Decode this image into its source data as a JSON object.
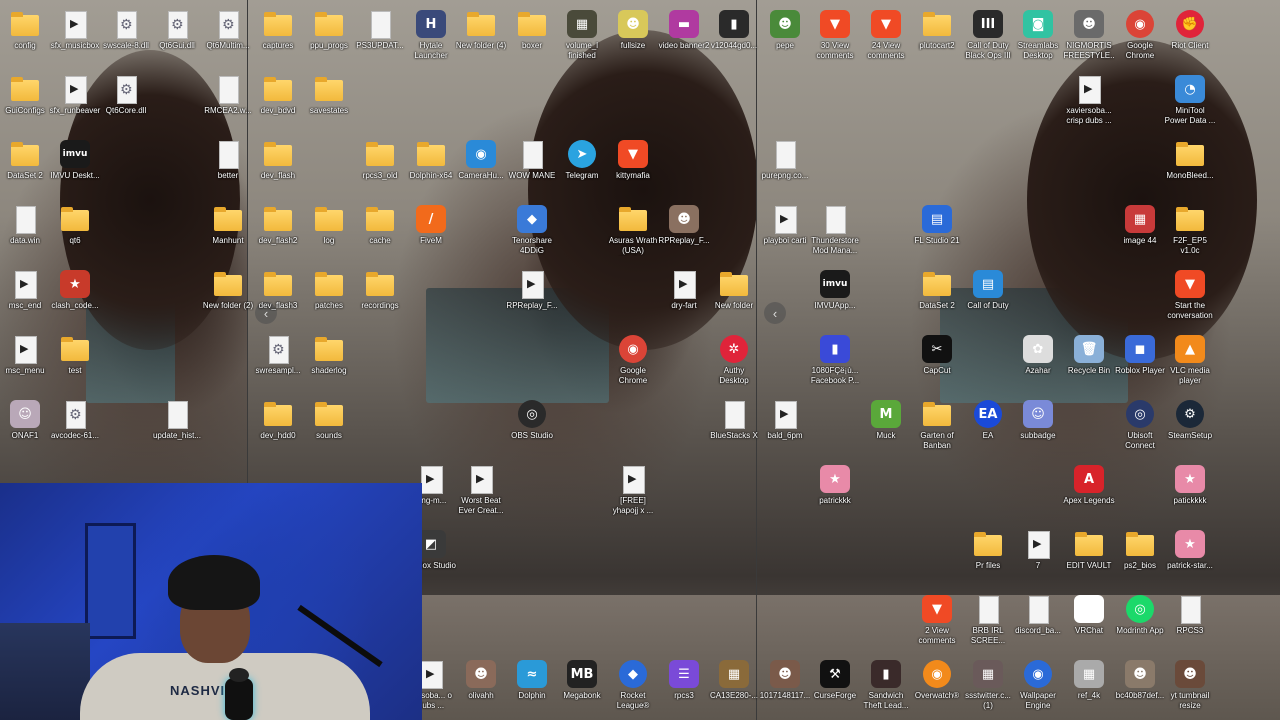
{
  "nav": {
    "left_arrow_1": "‹",
    "left_arrow_2": "‹"
  },
  "icons": [
    {
      "label": "config",
      "type": "folder",
      "color": "#f2b93c"
    },
    {
      "label": "sfx_musicbox",
      "type": "video",
      "color": "#ffffff"
    },
    {
      "label": "swscale-8.dll",
      "type": "gear",
      "color": "#ffffff"
    },
    {
      "label": "Qt6Gui.dll",
      "type": "gear",
      "color": "#ffffff"
    },
    {
      "label": "Qt6Multim...",
      "type": "gear",
      "color": "#ffffff"
    },
    {
      "label": "GuiConfigs",
      "type": "folder",
      "color": "#f2b93c"
    },
    {
      "label": "sfx_runbeaver",
      "type": "video",
      "color": "#ffffff"
    },
    {
      "label": "Qt6Core.dll",
      "type": "gear",
      "color": "#ffffff"
    },
    {
      "label": "RMCEA2.w...",
      "type": "file",
      "color": "#ffffff"
    },
    {
      "label": "DataSet 2",
      "type": "folder",
      "color": "#f2b93c"
    },
    {
      "label": "IMVU Deskt...",
      "type": "app",
      "color": "#1a1a1a",
      "glyph": "imvu"
    },
    {
      "label": "better",
      "type": "file",
      "color": "#ffffff"
    },
    {
      "label": "data.win",
      "type": "file",
      "color": "#ffffff"
    },
    {
      "label": "qt6",
      "type": "folder",
      "color": "#f2b93c"
    },
    {
      "label": "Manhunt",
      "type": "folder",
      "color": "#f2b93c"
    },
    {
      "label": "msc_end",
      "type": "video",
      "color": "#ffffff"
    },
    {
      "label": "clash_code...",
      "type": "app",
      "color": "#c83a2a",
      "glyph": "★"
    },
    {
      "label": "New folder (2)",
      "type": "folder",
      "color": "#f2b93c"
    },
    {
      "label": "msc_menu",
      "type": "video",
      "color": "#ffffff"
    },
    {
      "label": "test",
      "type": "folder",
      "color": "#f2b93c"
    },
    {
      "label": "ONAF1",
      "type": "app",
      "color": "#b9a8b8",
      "glyph": "☺"
    },
    {
      "label": "avcodec-61...",
      "type": "gear",
      "color": "#ffffff"
    },
    {
      "label": "update_hist...",
      "type": "file",
      "color": "#ffffff"
    },
    {
      "label": "captures",
      "type": "folder",
      "color": "#f2b93c"
    },
    {
      "label": "ppu_progs",
      "type": "folder",
      "color": "#f2b93c"
    },
    {
      "label": "PS3UPDAT...",
      "type": "file",
      "color": "#ffffff"
    },
    {
      "label": "Hytale Launcher",
      "type": "app",
      "color": "#3a4a7a",
      "glyph": "H"
    },
    {
      "label": "New folder (4)",
      "type": "folder",
      "color": "#f2b93c"
    },
    {
      "label": "boxer",
      "type": "folder",
      "color": "#f2b93c"
    },
    {
      "label": "volume_l finished",
      "type": "app",
      "color": "#4a4a3a",
      "glyph": "▦"
    },
    {
      "label": "fullsize",
      "type": "app",
      "color": "#d8c85a",
      "glyph": "☻"
    },
    {
      "label": "video banner2",
      "type": "app",
      "color": "#b03aa0",
      "glyph": "▬"
    },
    {
      "label": "v12044gd0...",
      "type": "app",
      "color": "#2a2a2a",
      "glyph": "▮"
    },
    {
      "label": "dev_bdvd",
      "type": "folder",
      "color": "#f2b93c"
    },
    {
      "label": "savestates",
      "type": "folder",
      "color": "#f2b93c"
    },
    {
      "label": "dev_flash",
      "type": "folder",
      "color": "#f2b93c"
    },
    {
      "label": "rpcs3_old",
      "type": "folder",
      "color": "#f2b93c"
    },
    {
      "label": "Dolphin-x64",
      "type": "folder",
      "color": "#f2b93c"
    },
    {
      "label": "CameraHu...",
      "type": "app",
      "color": "#2a8ad8",
      "glyph": "◉"
    },
    {
      "label": "WOW MANE",
      "type": "file",
      "color": "#ffffff"
    },
    {
      "label": "Telegram",
      "type": "round",
      "color": "#2aa3e0",
      "glyph": "➤"
    },
    {
      "label": "kittymafia",
      "type": "app",
      "color": "#f04a25",
      "glyph": "▼"
    },
    {
      "label": "dev_flash2",
      "type": "folder",
      "color": "#f2b93c"
    },
    {
      "label": "log",
      "type": "folder",
      "color": "#f2b93c"
    },
    {
      "label": "cache",
      "type": "folder",
      "color": "#f2b93c"
    },
    {
      "label": "FiveM",
      "type": "app",
      "color": "#f26a1b",
      "glyph": "/"
    },
    {
      "label": "Tenorshare 4DDiG",
      "type": "app",
      "color": "#3a7ad8",
      "glyph": "◆"
    },
    {
      "label": "Asuras Wrath (USA) (En,Ja...",
      "type": "folder",
      "color": "#f2b93c"
    },
    {
      "label": "RPReplay_F...",
      "type": "app",
      "color": "#8a7060",
      "glyph": "☻"
    },
    {
      "label": "dev_flash3",
      "type": "folder",
      "color": "#f2b93c"
    },
    {
      "label": "patches",
      "type": "folder",
      "color": "#f2b93c"
    },
    {
      "label": "recordings",
      "type": "folder",
      "color": "#f2b93c"
    },
    {
      "label": "RPReplay_F...",
      "type": "video",
      "color": "#ffffff"
    },
    {
      "label": "dry-fart",
      "type": "video",
      "color": "#ffffff"
    },
    {
      "label": "New folder",
      "type": "folder",
      "color": "#f2b93c"
    },
    {
      "label": "swresampl...",
      "type": "gear",
      "color": "#ffffff"
    },
    {
      "label": "shaderlog",
      "type": "folder",
      "color": "#f2b93c"
    },
    {
      "label": "Google Chrome",
      "type": "round",
      "color": "#db4437",
      "glyph": "◉"
    },
    {
      "label": "Authy Desktop",
      "type": "round",
      "color": "#e0243a",
      "glyph": "✲"
    },
    {
      "label": "dev_hdd0",
      "type": "folder",
      "color": "#f2b93c"
    },
    {
      "label": "sounds",
      "type": "folder",
      "color": "#f2b93c"
    },
    {
      "label": "OBS Studio",
      "type": "round",
      "color": "#2a2a2a",
      "glyph": "◎"
    },
    {
      "label": "BlueStacks X",
      "type": "file",
      "color": "#ffffff"
    },
    {
      "label": "king-m...",
      "type": "video",
      "color": "#ffffff"
    },
    {
      "label": "Worst Beat Ever Creat...",
      "type": "video",
      "color": "#ffffff"
    },
    {
      "label": "[FREE] yhapojj x ...",
      "type": "video",
      "color": "#ffffff"
    },
    {
      "label": "Roblox Studio",
      "type": "app",
      "color": "#3a3a3a",
      "glyph": "◩"
    },
    {
      "label": "pepe",
      "type": "app",
      "color": "#4a8a3a",
      "glyph": "☻"
    },
    {
      "label": "30 View comments",
      "type": "app",
      "color": "#f04a25",
      "glyph": "▼"
    },
    {
      "label": "24 View comments",
      "type": "app",
      "color": "#f04a25",
      "glyph": "▼"
    },
    {
      "label": "plutocart2",
      "type": "folder",
      "color": "#f2b93c"
    },
    {
      "label": "Call of Duty Black Ops III",
      "type": "app",
      "color": "#2a2a2a",
      "glyph": "III"
    },
    {
      "label": "Streamlabs Desktop",
      "type": "app",
      "color": "#31c3a2",
      "glyph": "◙"
    },
    {
      "label": "NIGMORTIS FREESTYLE...",
      "type": "app",
      "color": "#6a6a6a",
      "glyph": "☻"
    },
    {
      "label": "Google Chrome",
      "type": "round",
      "color": "#db4437",
      "glyph": "◉"
    },
    {
      "label": "Riot Client",
      "type": "round",
      "color": "#e0243a",
      "glyph": "✊"
    },
    {
      "label": "xaviersoba... crisp dubs ...",
      "type": "video",
      "color": "#ffffff"
    },
    {
      "label": "MiniTool Power Data ...",
      "type": "app",
      "color": "#3a8ad8",
      "glyph": "◔"
    },
    {
      "label": "purepng.co...",
      "type": "file",
      "color": "#ffffff"
    },
    {
      "label": "MonoBleed...",
      "type": "folder",
      "color": "#f2b93c"
    },
    {
      "label": "playboi carti",
      "type": "video",
      "color": "#ffffff"
    },
    {
      "label": "Thunderstore Mod Mana...",
      "type": "file",
      "color": "#ffffff"
    },
    {
      "label": "FL Studio 21",
      "type": "app",
      "color": "#2a6ad8",
      "glyph": "▤"
    },
    {
      "label": "image 44",
      "type": "app",
      "color": "#c83a3a",
      "glyph": "▦"
    },
    {
      "label": "F2F_EP5 v1.0c",
      "type": "folder",
      "color": "#f2b93c"
    },
    {
      "label": "IMVUApp...",
      "type": "app",
      "color": "#1a1a1a",
      "glyph": "imvu"
    },
    {
      "label": "DataSet 2",
      "type": "folder",
      "color": "#f2b93c"
    },
    {
      "label": "Call of Duty",
      "type": "app",
      "color": "#2a8ad8",
      "glyph": "▤"
    },
    {
      "label": "Start the conversation",
      "type": "app",
      "color": "#f04a25",
      "glyph": "▼"
    },
    {
      "label": "1080FÇë¡ù... Facebook P...",
      "type": "app",
      "color": "#3a4ad8",
      "glyph": "▮"
    },
    {
      "label": "CapCut",
      "type": "app",
      "color": "#111111",
      "glyph": "✂"
    },
    {
      "label": "Azahar",
      "type": "app",
      "color": "#dddddd",
      "glyph": "✿"
    },
    {
      "label": "Recycle Bin",
      "type": "app",
      "color": "#8ab0d8",
      "glyph": "🗑"
    },
    {
      "label": "Roblox Player",
      "type": "app",
      "color": "#3a6ad8",
      "glyph": "◼"
    },
    {
      "label": "VLC media player",
      "type": "app",
      "color": "#f28a1b",
      "glyph": "▲"
    },
    {
      "label": "bald_6pm",
      "type": "video",
      "color": "#ffffff"
    },
    {
      "label": "Muck",
      "type": "app",
      "color": "#5aa83a",
      "glyph": "M"
    },
    {
      "label": "Garten of Banban",
      "type": "folder",
      "color": "#f2b93c"
    },
    {
      "label": "EA",
      "type": "round",
      "color": "#1a4ad8",
      "glyph": "EA"
    },
    {
      "label": "subbadge",
      "type": "app",
      "color": "#7a8ad8",
      "glyph": "☺"
    },
    {
      "label": "Ubisoft Connect",
      "type": "round",
      "color": "#2a3a6a",
      "glyph": "◎"
    },
    {
      "label": "SteamSetup",
      "type": "round",
      "color": "#1b2838",
      "glyph": "⚙"
    },
    {
      "label": "patrickkk",
      "type": "app",
      "color": "#e88aa8",
      "glyph": "★"
    },
    {
      "label": "Apex Legends",
      "type": "app",
      "color": "#d8232a",
      "glyph": "A"
    },
    {
      "label": "patickkkk",
      "type": "app",
      "color": "#e88aa8",
      "glyph": "★"
    },
    {
      "label": "Pr files",
      "type": "folder",
      "color": "#f2b93c"
    },
    {
      "label": "7",
      "type": "video",
      "color": "#ffffff"
    },
    {
      "label": "EDIT VAULT",
      "type": "folder",
      "color": "#f2b93c"
    },
    {
      "label": "ps2_bios",
      "type": "folder",
      "color": "#f2b93c"
    },
    {
      "label": "patrick-star...",
      "type": "app",
      "color": "#e88aa8",
      "glyph": "★"
    },
    {
      "label": "2 View comments",
      "type": "app",
      "color": "#f04a25",
      "glyph": "▼"
    },
    {
      "label": "BRB IRL SCREE...",
      "type": "file",
      "color": "#ffffff"
    },
    {
      "label": "discord_ba...",
      "type": "file",
      "color": "#ffffff"
    },
    {
      "label": "VRChat",
      "type": "app",
      "color": "#ffffff",
      "glyph": "VR"
    },
    {
      "label": "Modrinth App",
      "type": "round",
      "color": "#1bd96a",
      "glyph": "◎"
    },
    {
      "label": "RPCS3",
      "type": "file",
      "color": "#ffffff"
    },
    {
      "label": "xersoba... o dubs ...",
      "type": "video",
      "color": "#ffffff"
    },
    {
      "label": "olivahh",
      "type": "app",
      "color": "#8a6a5a",
      "glyph": "☻"
    },
    {
      "label": "Dolphin",
      "type": "app",
      "color": "#2a9ad8",
      "glyph": "≈"
    },
    {
      "label": "Megabonk",
      "type": "app",
      "color": "#222222",
      "glyph": "MB"
    },
    {
      "label": "Rocket League®",
      "type": "round",
      "color": "#2a6ad8",
      "glyph": "◆"
    },
    {
      "label": "rpcs3",
      "type": "app",
      "color": "#7a4ad8",
      "glyph": "☰"
    },
    {
      "label": "CA13E280-...",
      "type": "app",
      "color": "#8a6a3a",
      "glyph": "▦"
    },
    {
      "label": "1017148117...",
      "type": "app",
      "color": "#7a5a4a",
      "glyph": "☻"
    },
    {
      "label": "CurseForge",
      "type": "app",
      "color": "#111111",
      "glyph": "⚒"
    },
    {
      "label": "Sandwich Theft Lead...",
      "type": "app",
      "color": "#3a2a2a",
      "glyph": "▮"
    },
    {
      "label": "Overwatch®",
      "type": "round",
      "color": "#f28a1b",
      "glyph": "◉"
    },
    {
      "label": "ssstwitter.c... (1)",
      "type": "app",
      "color": "#6a5a5a",
      "glyph": "▦"
    },
    {
      "label": "Wallpaper Engine",
      "type": "round",
      "color": "#2a6ad8",
      "glyph": "◉"
    },
    {
      "label": "ref_4k",
      "type": "app",
      "color": "#aaaaaa",
      "glyph": "▦"
    },
    {
      "label": "bc40b87def...",
      "type": "app",
      "color": "#8a7a6a",
      "glyph": "☻"
    },
    {
      "label": "yt tumbnail resize",
      "type": "app",
      "color": "#6a4a3a",
      "glyph": "☻"
    }
  ],
  "webcam": {
    "shirt_text": "NASHVILLE"
  }
}
